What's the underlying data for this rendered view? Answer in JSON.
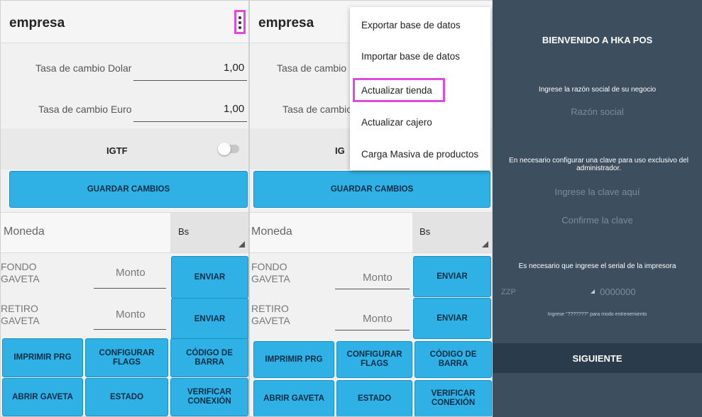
{
  "left_screen": {
    "appbar_title": "empresa",
    "rate_dollar_label": "Tasa de cambio Dolar",
    "rate_dollar_value": "1,00",
    "rate_euro_label": "Tasa de cambio Euro",
    "rate_euro_value": "1,00",
    "igtf_label": "IGTF",
    "save_button": "GUARDAR CAMBIOS",
    "moneda_label": "Moneda",
    "moneda_value": "Bs",
    "fondo_label_line1": "FONDO",
    "fondo_label_line2": "GAVETA",
    "fondo_placeholder": "Monto",
    "fondo_send": "ENVIAR",
    "retiro_label_line1": "RETIRO",
    "retiro_label_line2": "GAVETA",
    "retiro_placeholder": "Monto",
    "retiro_send": "ENVIAR",
    "btn_imprimir": "IMPRIMIR PRG",
    "btn_configurar": "CONFIGURAR FLAGS",
    "btn_codigo": "CÓDIGO DE BARRA",
    "btn_abrir": "ABRIR GAVETA",
    "btn_estado": "ESTADO",
    "btn_verificar": "VERIFICAR CONEXIÓN"
  },
  "middle_screen": {
    "appbar_title": "empresa",
    "rate_dollar_label_partial": "Tasa de cambio I",
    "rate_euro_label_partial": "Tasa de cambio",
    "igtf_partial": "IG",
    "save_button": "GUARDAR CAMBIOS",
    "moneda_label": "Moneda",
    "moneda_value": "Bs",
    "fondo_label_line1": "FONDO",
    "fondo_label_line2": "GAVETA",
    "fondo_placeholder": "Monto",
    "fondo_send": "ENVIAR",
    "retiro_label_line1": "RETIRO",
    "retiro_label_line2": "GAVETA",
    "retiro_placeholder": "Monto",
    "retiro_send": "ENVIAR",
    "btn_imprimir": "IMPRIMIR PRG",
    "btn_configurar": "CONFIGURAR FLAGS",
    "btn_codigo": "CÓDIGO DE BARRA",
    "btn_abrir": "ABRIR GAVETA",
    "btn_estado": "ESTADO",
    "btn_verificar": "VERIFICAR CONEXIÓN",
    "menu": [
      "Exportar base de datos",
      "Importar base de datos",
      "Actualizar tienda",
      "Actualizar cajero",
      "Carga Masiva de productos"
    ]
  },
  "welcome_screen": {
    "title": "BIENVENIDO A HKA POS",
    "razon_prompt": "Ingrese la razón social de su negocio",
    "razon_hint": "Razón social",
    "clave_prompt": "En necesario configurar una clave para uso exclusivo del administrador.",
    "clave_hint": "Ingrese la clave aquí",
    "confirm_hint": "Confirme la clave",
    "serial_prompt": "Es necesario que ingrese el serial de la impresora",
    "serial_prefix": "ZZP",
    "serial_hint": "0000000",
    "training_note": "Ingrese \"???????\" para modo entrenemiento",
    "next_button": "SIGUIENTE"
  },
  "colors": {
    "button_blue": "#2fb1e6",
    "highlight_magenta": "#e04ae0",
    "welcome_bg": "#3d4e5e",
    "welcome_button_bg": "#2a3b4c"
  },
  "icons": [
    "more-vert-icon",
    "dropdown-triangle-icon",
    "toggle-switch"
  ]
}
